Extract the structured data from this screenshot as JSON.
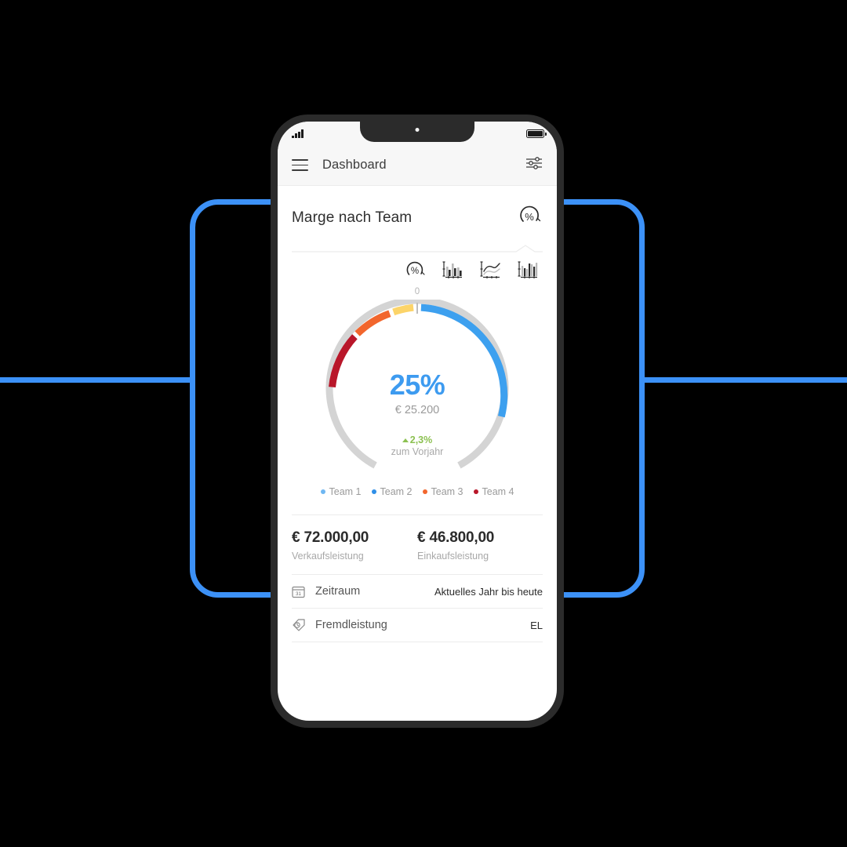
{
  "statusbar": {
    "signal_icon": "signal-bars-icon",
    "battery_icon": "battery-full-icon"
  },
  "appbar": {
    "menu_icon": "hamburger-menu-icon",
    "title": "Dashboard",
    "filter_icon": "settings-sliders-icon"
  },
  "card": {
    "title": "Marge nach Team",
    "badge_icon": "gauge-percent-icon",
    "chart_types": [
      {
        "name": "chart-type-gauge",
        "icon": "gauge-percent-icon",
        "active": true
      },
      {
        "name": "chart-type-bar",
        "icon": "bar-chart-icon",
        "active": false
      },
      {
        "name": "chart-type-line",
        "icon": "line-chart-icon",
        "active": false
      },
      {
        "name": "chart-type-column",
        "icon": "column-chart-icon",
        "active": false
      }
    ]
  },
  "gauge": {
    "zero_label": "0",
    "percent": "25%",
    "amount": "€ 25.200",
    "delta_value": "2,3%",
    "delta_label": "zum Vorjahr",
    "delta_direction": "up",
    "percent_color": "#3d9bf0",
    "delta_color": "#8cc152",
    "track_color": "#d4d4d4"
  },
  "legend": [
    {
      "label": "Team 1",
      "color": "#6fb7f2"
    },
    {
      "label": "Team 2",
      "color": "#2f8fe8"
    },
    {
      "label": "Team 3",
      "color": "#f2662d"
    },
    {
      "label": "Team 4",
      "color": "#b9172a"
    }
  ],
  "kpis": [
    {
      "value": "€ 72.000,00",
      "label": "Verkaufsleistung"
    },
    {
      "value": "€ 46.800,00",
      "label": "Einkaufsleistung"
    }
  ],
  "settings_rows": [
    {
      "icon": "calendar-icon",
      "label": "Zeitraum",
      "value": "Aktuelles Jahr bis heute"
    },
    {
      "icon": "tag-icon",
      "label": "Fremdleistung",
      "value": "EL"
    }
  ],
  "chart_data": {
    "type": "pie",
    "title": "Marge nach Team",
    "subtitle": "€ 25.200",
    "center_value": 25,
    "unit": "%",
    "total_label": "€ 25.200",
    "categories": [
      "Team 1",
      "Team 2",
      "Team 3",
      "Team 4"
    ],
    "values": [
      52,
      9,
      16,
      23
    ],
    "colors": [
      "#3da0ef",
      "#fcd469",
      "#f2662d",
      "#b9172a"
    ],
    "legend_position": "bottom",
    "grid": false,
    "annotations": [
      "0",
      "25%",
      "€ 25.200",
      "2,3%",
      "zum Vorjahr"
    ],
    "axis_start_label": "0"
  },
  "decor": {
    "frame_color": "#3c91f7"
  }
}
